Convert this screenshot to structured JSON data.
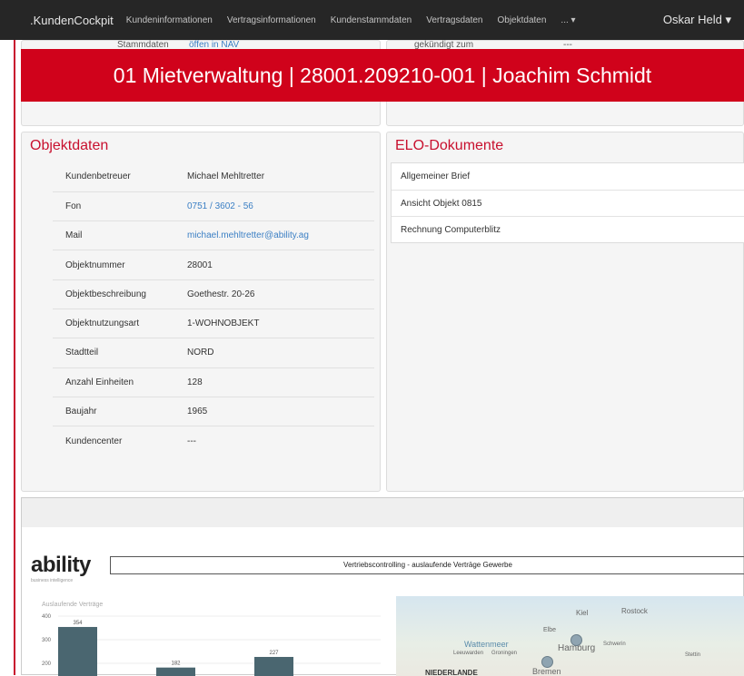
{
  "navbar": {
    "brand": ".KundenCockpit",
    "links": [
      "Kundeninformationen",
      "Vertragsinformationen",
      "Kundenstammdaten",
      "Vertragsdaten",
      "Objektdaten",
      "... ▾"
    ],
    "user": "Oskar Held ▾"
  },
  "peek": {
    "left_label": "Stammdaten",
    "left_value": "öffen in NAV",
    "right_label": "gekündigt zum",
    "right_value": "---"
  },
  "banner": {
    "title": "01 Mietverwaltung | 28001.209210-001 | Joachim Schmidt"
  },
  "objektdaten": {
    "title": "Objektdaten",
    "rows": [
      {
        "label": "Kundenbetreuer",
        "value": "Michael Mehltretter"
      },
      {
        "label": "Fon",
        "value": "0751 / 3602 - 56"
      },
      {
        "label": "Mail",
        "value": "michael.mehltretter@ability.ag"
      },
      {
        "label": "Objektnummer",
        "value": "28001"
      },
      {
        "label": "Objektbeschreibung",
        "value": "Goethestr. 20-26"
      },
      {
        "label": "Objektnutzungsart",
        "value": "1-WOHNOBJEKT"
      },
      {
        "label": "Stadtteil",
        "value": "NORD"
      },
      {
        "label": "Anzahl Einheiten",
        "value": "128"
      },
      {
        "label": "Baujahr",
        "value": "1965"
      },
      {
        "label": "Kundencenter",
        "value": "---"
      }
    ]
  },
  "elo": {
    "title": "ELO-Dokumente",
    "items": [
      "Allgemeiner Brief",
      "Ansicht Objekt 0815",
      "Rechnung Computerblitz"
    ]
  },
  "report": {
    "logo": "ability",
    "logo_sub": "business intelligence",
    "title": "Vertriebscontrolling - auslaufende Verträge Gewerbe",
    "chart_label": "Auslaufende Verträge",
    "map_labels": [
      "Kiel",
      "Rostock",
      "Wattenmeer",
      "Leeuwarden",
      "Groningen",
      "Elbe",
      "Hamburg",
      "Schwerin",
      "Bremen",
      "Stettin",
      "NIEDERLANDE"
    ]
  },
  "chart_data": {
    "type": "bar",
    "title": "Auslaufende Verträge",
    "categories": [
      "",
      "",
      ""
    ],
    "values": [
      354,
      182,
      227
    ],
    "yticks": [
      400,
      300,
      200
    ],
    "ylim": [
      0,
      400
    ],
    "color": "#4a6670"
  },
  "colors": {
    "accent": "#d0021b",
    "link": "#3b7fc4"
  }
}
